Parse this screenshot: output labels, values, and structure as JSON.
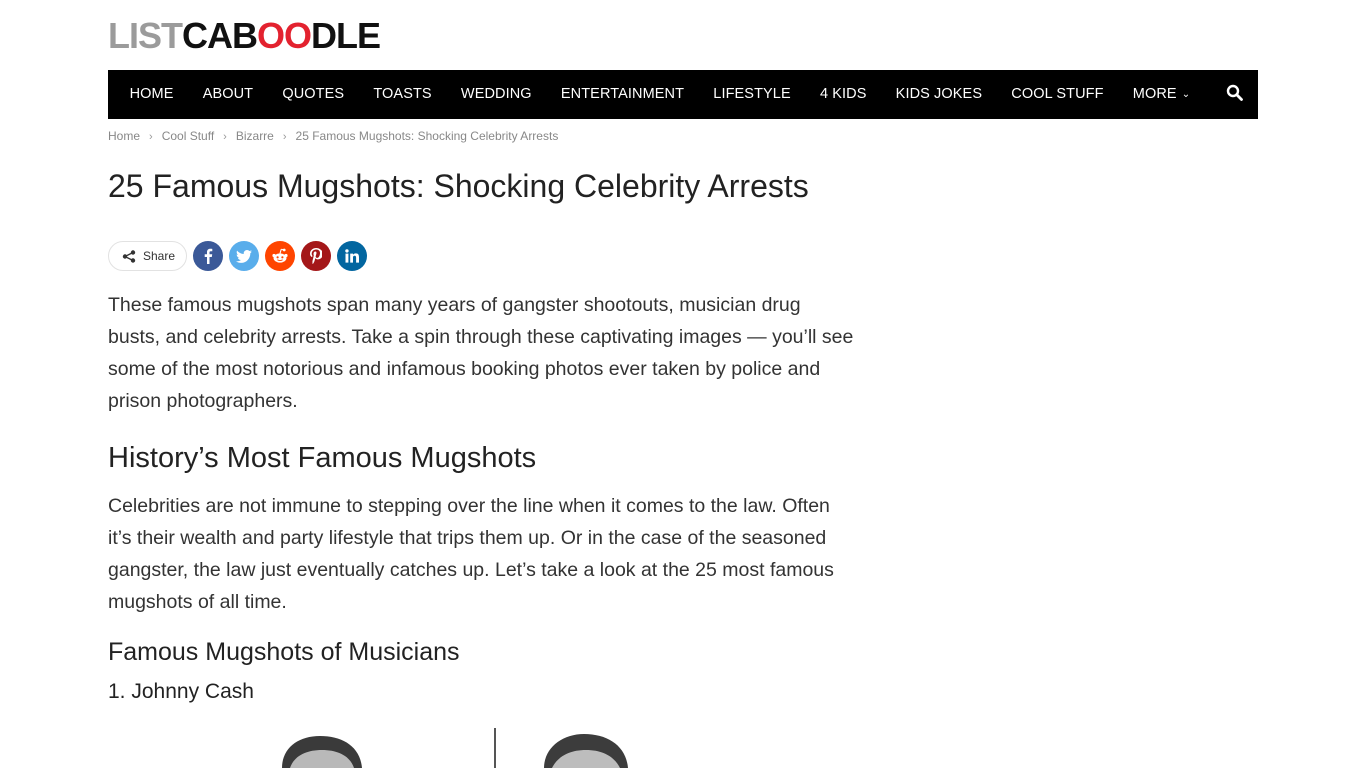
{
  "logo": {
    "part1": "LIST",
    "part2": "CAB",
    "part3": "OO",
    "part4": "DLE"
  },
  "nav": {
    "items": [
      "HOME",
      "ABOUT",
      "QUOTES",
      "TOASTS",
      "WEDDING",
      "ENTERTAINMENT",
      "LIFESTYLE",
      "4 KIDS",
      "KIDS JOKES",
      "COOL STUFF",
      "MORE"
    ],
    "search_icon": "search-icon"
  },
  "breadcrumb": [
    "Home",
    "Cool Stuff",
    "Bizarre",
    "25 Famous Mugshots: Shocking Celebrity Arrests"
  ],
  "article": {
    "title": "25 Famous Mugshots: Shocking Celebrity Arrests",
    "share_label": "Share",
    "social": [
      {
        "name": "facebook",
        "color": "#3b5998"
      },
      {
        "name": "twitter",
        "color": "#59adeb"
      },
      {
        "name": "reddit",
        "color": "#ff4500"
      },
      {
        "name": "pinterest",
        "color": "#a41719"
      },
      {
        "name": "linkedin",
        "color": "#0266a0"
      }
    ],
    "intro": "These famous mugshots span many years of gangster shootouts, musician drug busts, and celebrity arrests. Take a spin through these captivating images — you’ll see some of the most notorious and infamous booking photos ever taken by police and prison photographers.",
    "h2": "History’s Most Famous Mugshots",
    "para2": "Celebrities are not immune to stepping over the line when it comes to the law. Often it’s their wealth and party lifestyle that trips them up. Or in the case of the seasoned gangster, the law just eventually catches up. Let’s take a look at the 25 most famous mugshots of all time.",
    "h3": "Famous Mugshots of Musicians",
    "h4": "1. Johnny Cash"
  }
}
